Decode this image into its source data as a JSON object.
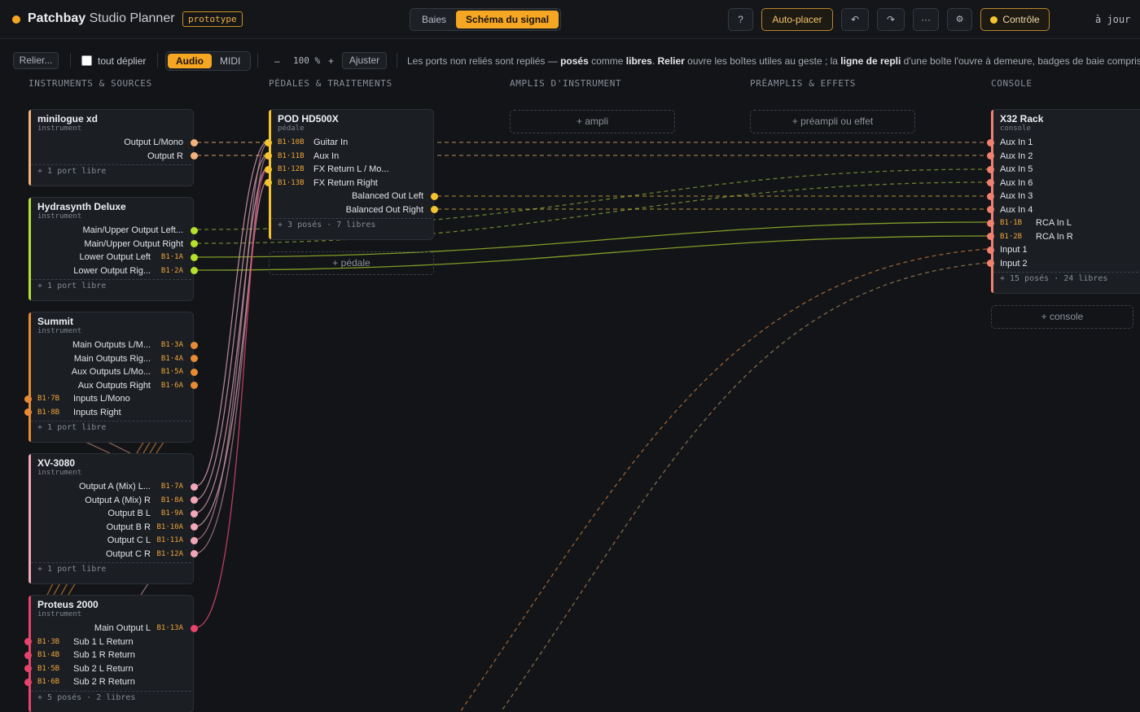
{
  "app": {
    "title_bold": "Patchbay",
    "title_rest": "Studio Planner",
    "badge": "prototype",
    "tabs": [
      "Baies",
      "Schéma du signal"
    ],
    "active_tab": "Schéma du signal",
    "help": "?",
    "auto_place": "Auto-placer",
    "undo": "↶",
    "redo": "↷",
    "more": "···",
    "settings": "⚙",
    "control": "Contrôle",
    "updated": "à jour"
  },
  "toolbar": {
    "relink": "Relier...",
    "expand_all": "tout déplier",
    "modes": [
      "Audio",
      "MIDI"
    ],
    "active_mode": "Audio",
    "zoom_out": "–",
    "zoom": "100 %",
    "zoom_in": "+",
    "fit": "Ajuster",
    "hint": [
      {
        "t": "Les ports non reliés sont repliés — ",
        "b": false
      },
      {
        "t": "posés",
        "b": true
      },
      {
        "t": " comme ",
        "b": false
      },
      {
        "t": "libres",
        "b": true
      },
      {
        "t": ". ",
        "b": false
      },
      {
        "t": "Relier",
        "b": true
      },
      {
        "t": " ouvre les boîtes utiles au geste ; la ",
        "b": false
      },
      {
        "t": "ligne de repli",
        "b": true
      },
      {
        "t": " d'une boîte l'ouvre à demeure, badges de baie compris.",
        "b": false
      }
    ]
  },
  "columns": [
    "INSTRUMENTS & SOURCES",
    "PÉDALES & TRAITEMENTS",
    "AMPLIS D'INSTRUMENT",
    "PRÉAMPLIS & EFFETS",
    "CONSOLE"
  ],
  "colors": {
    "accent": "#f5a623",
    "peach": "#f2b27a",
    "lime": "#b5e02d",
    "amber": "#e88a33",
    "pink": "#f2a6b8",
    "red": "#e8436a",
    "gold": "#f5c330",
    "salmon": "#f08070"
  },
  "devices": [
    {
      "name": "minilogue xd",
      "kind": "instrument",
      "color": "peach",
      "ports": [
        {
          "label": "Output L/Mono",
          "tag": "",
          "side": "out"
        },
        {
          "label": "Output R",
          "tag": "",
          "side": "out"
        }
      ],
      "footer": "+ 1 port libre"
    },
    {
      "name": "Hydrasynth Deluxe",
      "kind": "instrument",
      "color": "lime",
      "ports": [
        {
          "label": "Main/Upper Output Left...",
          "tag": "",
          "side": "out"
        },
        {
          "label": "Main/Upper Output Right",
          "tag": "",
          "side": "out"
        },
        {
          "label": "Lower Output Left",
          "tag": "B1·1A",
          "side": "out"
        },
        {
          "label": "Lower Output Rig...",
          "tag": "B1·2A",
          "side": "out"
        }
      ],
      "footer": "+ 1 port libre"
    },
    {
      "name": "Summit",
      "kind": "instrument",
      "color": "amber",
      "ports": [
        {
          "label": "Main Outputs L/M...",
          "tag": "B1·3A",
          "side": "out"
        },
        {
          "label": "Main Outputs Rig...",
          "tag": "B1·4A",
          "side": "out"
        },
        {
          "label": "Aux Outputs L/Mo...",
          "tag": "B1·5A",
          "side": "out"
        },
        {
          "label": "Aux Outputs Right",
          "tag": "B1·6A",
          "side": "out"
        },
        {
          "label": "Inputs L/Mono",
          "tag": "B1·7B",
          "side": "in"
        },
        {
          "label": "Inputs Right",
          "tag": "B1·8B",
          "side": "in"
        }
      ],
      "footer": "+ 1 port libre"
    },
    {
      "name": "XV-3080",
      "kind": "instrument",
      "color": "pink",
      "ports": [
        {
          "label": "Output A (Mix) L...",
          "tag": "B1·7A",
          "side": "out"
        },
        {
          "label": "Output A (Mix) R",
          "tag": "B1·8A",
          "side": "out"
        },
        {
          "label": "Output B L",
          "tag": "B1·9A",
          "side": "out"
        },
        {
          "label": "Output B R",
          "tag": "B1·10A",
          "side": "out"
        },
        {
          "label": "Output C L",
          "tag": "B1·11A",
          "side": "out"
        },
        {
          "label": "Output C R",
          "tag": "B1·12A",
          "side": "out"
        }
      ],
      "footer": "+ 1 port libre"
    },
    {
      "name": "Proteus 2000",
      "kind": "instrument",
      "color": "red",
      "ports": [
        {
          "label": "Main Output L",
          "tag": "B1·13A",
          "side": "out"
        },
        {
          "label": "Sub 1 L Return",
          "tag": "B1·3B",
          "side": "in"
        },
        {
          "label": "Sub 1 R Return",
          "tag": "B1·4B",
          "side": "in"
        },
        {
          "label": "Sub 2 L Return",
          "tag": "B1·5B",
          "side": "in"
        },
        {
          "label": "Sub 2 R Return",
          "tag": "B1·6B",
          "side": "in"
        }
      ],
      "footer": "+ 5 posés · 2 libres"
    },
    {
      "name": "POD HD500X",
      "kind": "pédale",
      "color": "gold",
      "ports": [
        {
          "label": "Guitar In",
          "tag": "B1·10B",
          "side": "in"
        },
        {
          "label": "Aux In",
          "tag": "B1·11B",
          "side": "in"
        },
        {
          "label": "FX Return L / Mo...",
          "tag": "B1·12B",
          "side": "in"
        },
        {
          "label": "FX Return Right",
          "tag": "B1·13B",
          "side": "in"
        },
        {
          "label": "Balanced Out Left",
          "tag": "",
          "side": "out"
        },
        {
          "label": "Balanced Out Right",
          "tag": "",
          "side": "out"
        }
      ],
      "footer": "+ 3 posés · 7 libres"
    },
    {
      "name": "X32 Rack",
      "kind": "console",
      "color": "salmon",
      "ports": [
        {
          "label": "Aux In 1",
          "tag": "",
          "side": "in"
        },
        {
          "label": "Aux In 2",
          "tag": "",
          "side": "in"
        },
        {
          "label": "Aux In 5",
          "tag": "",
          "side": "in"
        },
        {
          "label": "Aux In 6",
          "tag": "",
          "side": "in"
        },
        {
          "label": "Aux In 3",
          "tag": "",
          "side": "in"
        },
        {
          "label": "Aux In 4",
          "tag": "",
          "side": "in"
        },
        {
          "label": "RCA In L",
          "tag": "B1·1B",
          "side": "in"
        },
        {
          "label": "RCA In R",
          "tag": "B1·2B",
          "side": "in"
        },
        {
          "label": "Input 1",
          "tag": "",
          "side": "in"
        },
        {
          "label": "Input 2",
          "tag": "",
          "side": "in"
        }
      ],
      "footer": "+ 15 posés · 24 libres"
    }
  ],
  "placeholders": {
    "pedal": "+ pédale",
    "amp": "+ ampli",
    "preamp": "+ préampli ou effet",
    "console": "+ console"
  }
}
